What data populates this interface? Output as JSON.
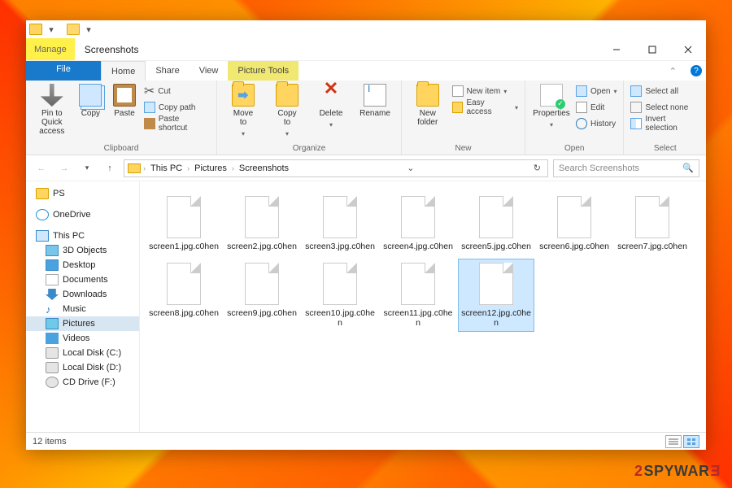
{
  "window": {
    "title": "Screenshots",
    "context_tab": "Manage",
    "context_sub": "Picture Tools"
  },
  "tabs": {
    "file": "File",
    "home": "Home",
    "share": "Share",
    "view": "View"
  },
  "ribbon": {
    "clipboard": {
      "name": "Clipboard",
      "pin": "Pin to Quick\naccess",
      "copy": "Copy",
      "paste": "Paste",
      "cut": "Cut",
      "copy_path": "Copy path",
      "paste_shortcut": "Paste shortcut"
    },
    "organize": {
      "name": "Organize",
      "move": "Move\nto",
      "copy": "Copy\nto",
      "delete": "Delete",
      "rename": "Rename"
    },
    "new": {
      "name": "New",
      "folder": "New\nfolder",
      "new_item": "New item",
      "easy_access": "Easy access"
    },
    "open": {
      "name": "Open",
      "properties": "Properties",
      "open": "Open",
      "edit": "Edit",
      "history": "History"
    },
    "select": {
      "name": "Select",
      "all": "Select all",
      "none": "Select none",
      "invert": "Invert selection"
    }
  },
  "breadcrumb": [
    "This PC",
    "Pictures",
    "Screenshots"
  ],
  "search_placeholder": "Search Screenshots",
  "tree": {
    "ps": "PS",
    "onedrive": "OneDrive",
    "this_pc": "This PC",
    "objects3d": "3D Objects",
    "desktop": "Desktop",
    "documents": "Documents",
    "downloads": "Downloads",
    "music": "Music",
    "pictures": "Pictures",
    "videos": "Videos",
    "disk_c": "Local Disk (C:)",
    "disk_d": "Local Disk (D:)",
    "cd": "CD Drive (F:)"
  },
  "files": [
    {
      "name": "screen1.jpg.c0hen"
    },
    {
      "name": "screen2.jpg.c0hen"
    },
    {
      "name": "screen3.jpg.c0hen"
    },
    {
      "name": "screen4.jpg.c0hen"
    },
    {
      "name": "screen5.jpg.c0hen"
    },
    {
      "name": "screen6.jpg.c0hen"
    },
    {
      "name": "screen7.jpg.c0hen"
    },
    {
      "name": "screen8.jpg.c0hen"
    },
    {
      "name": "screen9.jpg.c0hen"
    },
    {
      "name": "screen10.jpg.c0hen"
    },
    {
      "name": "screen11.jpg.c0hen"
    },
    {
      "name": "screen12.jpg.c0hen",
      "selected": true
    }
  ],
  "status": {
    "count": "12 items"
  },
  "watermark": {
    "two": "2",
    "brand": "SPYWAR"
  }
}
